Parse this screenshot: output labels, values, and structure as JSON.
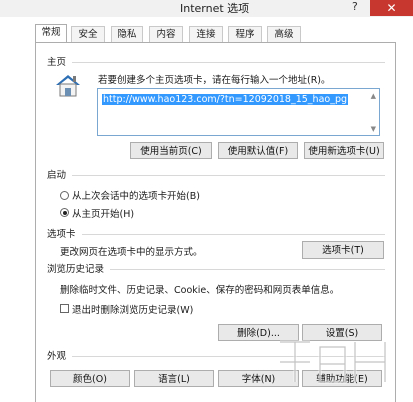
{
  "window": {
    "title": "Internet 选项",
    "help": "?",
    "close": "✕"
  },
  "tabs": [
    {
      "label": "常规",
      "active": true
    },
    {
      "label": "安全"
    },
    {
      "label": "隐私"
    },
    {
      "label": "内容"
    },
    {
      "label": "连接"
    },
    {
      "label": "程序"
    },
    {
      "label": "高级"
    }
  ],
  "home": {
    "heading": "主页",
    "instruction": "若要创建多个主页选项卡，请在每行输入一个地址(R)。",
    "url": "http://www.hao123.com/?tn=12092018_15_hao_pg",
    "buttons": {
      "current": "使用当前页(C)",
      "default": "使用默认值(F)",
      "new_tab": "使用新选项卡(U)"
    }
  },
  "startup": {
    "heading": "启动",
    "options": [
      {
        "label": "从上次会话中的选项卡开始(B)",
        "selected": false
      },
      {
        "label": "从主页开始(H)",
        "selected": true
      }
    ]
  },
  "tabs_section": {
    "heading": "选项卡",
    "description": "更改网页在选项卡中的显示方式。",
    "button": "选项卡(T)"
  },
  "history": {
    "heading": "浏览历史记录",
    "description": "删除临时文件、历史记录、Cookie、保存的密码和网页表单信息。",
    "checkbox": {
      "label": "退出时删除浏览历史记录(W)",
      "checked": false
    },
    "delete_button": "删除(D)...",
    "settings_button": "设置(S)"
  },
  "appearance": {
    "heading": "外观",
    "buttons": {
      "colors": "颜色(O)",
      "languages": "语言(L)",
      "fonts": "字体(N)",
      "accessibility": "辅助功能(E)"
    }
  },
  "colors": {
    "close_bg": "#c7372f",
    "selection": "#3399ff",
    "url_border": "#7aa7d1",
    "house_roof": "#2d6fb5"
  },
  "icons": {
    "home": "home-house-icon",
    "watermark": "watermark-logo-icon"
  }
}
